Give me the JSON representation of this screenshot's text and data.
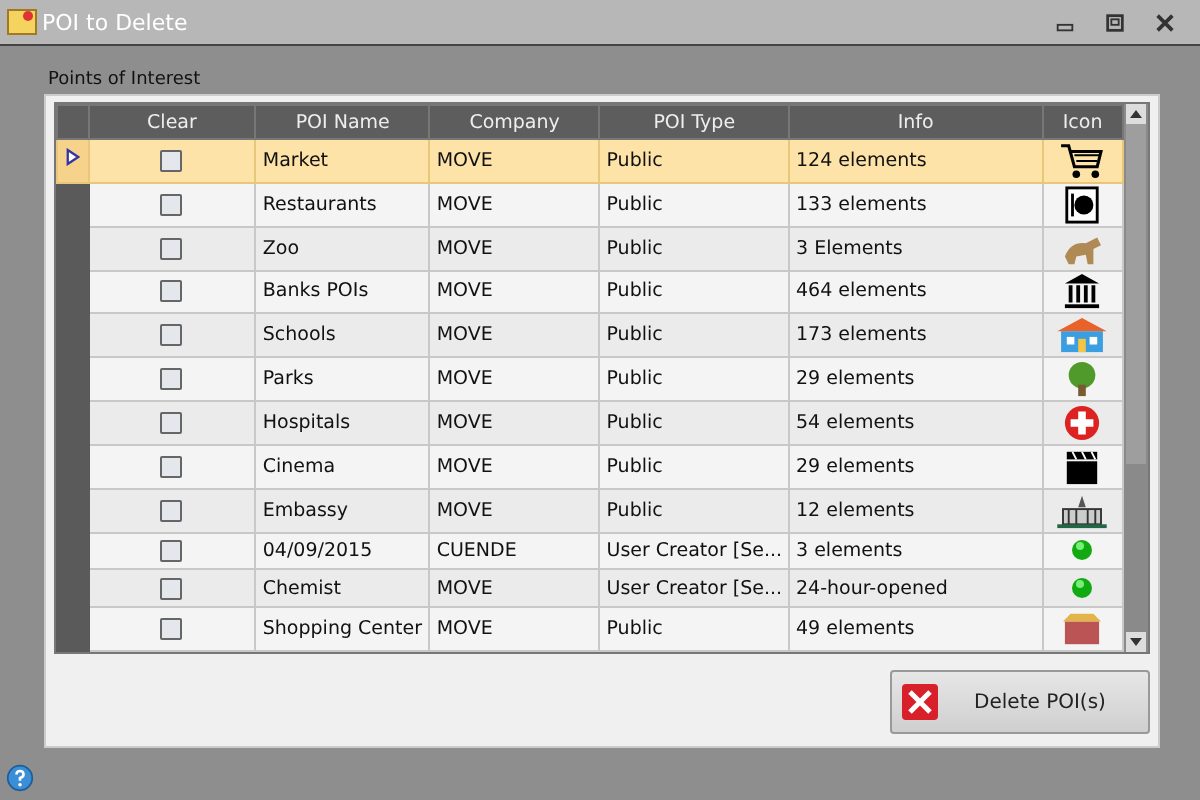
{
  "window": {
    "title": "POI to Delete"
  },
  "group_label": "Points of Interest",
  "table": {
    "columns": [
      "Clear",
      "POI Name",
      "Company",
      "POI Type",
      "Info",
      "Icon"
    ],
    "rows": [
      {
        "selected": true,
        "checked": false,
        "name": "Market",
        "company": "MOVE",
        "type": "Public",
        "info": "124 elements"
      },
      {
        "selected": false,
        "checked": false,
        "name": "Restaurants",
        "company": "MOVE",
        "type": "Public",
        "info": "133 elements"
      },
      {
        "selected": false,
        "checked": false,
        "name": "Zoo",
        "company": "MOVE",
        "type": "Public",
        "info": "3 Elements"
      },
      {
        "selected": false,
        "checked": false,
        "name": "Banks POIs",
        "company": "MOVE",
        "type": "Public",
        "info": "464 elements"
      },
      {
        "selected": false,
        "checked": false,
        "name": "Schools",
        "company": "MOVE",
        "type": "Public",
        "info": "173 elements"
      },
      {
        "selected": false,
        "checked": false,
        "name": "Parks",
        "company": "MOVE",
        "type": "Public",
        "info": "29 elements"
      },
      {
        "selected": false,
        "checked": false,
        "name": "Hospitals",
        "company": "MOVE",
        "type": "Public",
        "info": "54 elements"
      },
      {
        "selected": false,
        "checked": false,
        "name": "Cinema",
        "company": "MOVE",
        "type": "Public",
        "info": "29 elements"
      },
      {
        "selected": false,
        "checked": false,
        "name": "Embassy",
        "company": "MOVE",
        "type": "Public",
        "info": "12 elements"
      },
      {
        "selected": false,
        "checked": false,
        "name": "04/09/2015",
        "company": "CUENDE",
        "type": "User Creator [Se...",
        "info": "3 elements"
      },
      {
        "selected": false,
        "checked": false,
        "name": "Chemist",
        "company": "MOVE",
        "type": "User Creator [Se...",
        "info": "24-hour-opened"
      },
      {
        "selected": false,
        "checked": false,
        "name": "Shopping Center",
        "company": "MOVE",
        "type": "Public",
        "info": "49 elements"
      }
    ]
  },
  "delete_button": "Delete POI(s)"
}
